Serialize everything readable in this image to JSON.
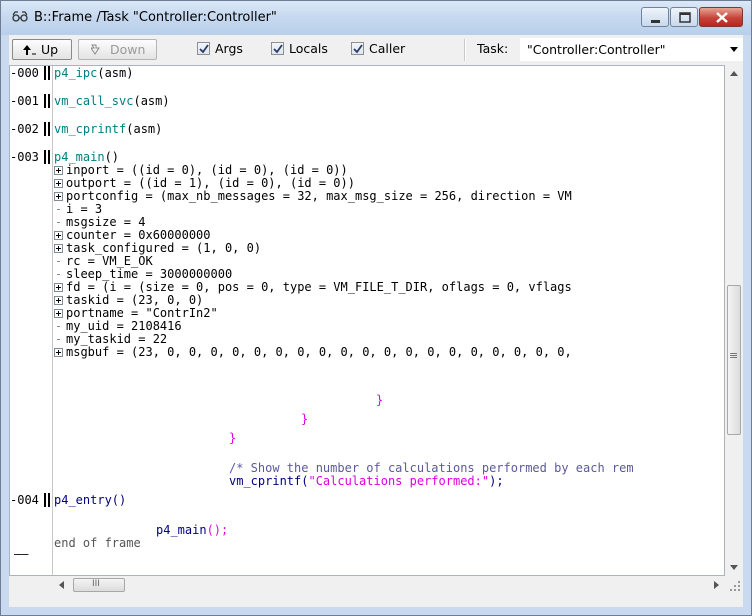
{
  "window": {
    "title": "B::Frame /Task \"Controller:Controller\"",
    "accent": "#c9daee"
  },
  "toolbar": {
    "up_label": "Up",
    "down_label": "Down",
    "args_label": "Args",
    "args_checked": true,
    "locals_label": "Locals",
    "locals_checked": true,
    "caller_label": "Caller",
    "caller_checked": true,
    "task_label": "Task:",
    "task_value": "\"Controller:Controller\""
  },
  "frames": [
    {
      "num": "-000",
      "func": "p4_ipc",
      "suffix": "(asm)"
    },
    {
      "num": "-001",
      "func": "vm_call_svc",
      "suffix": "(asm)"
    },
    {
      "num": "-002",
      "func": "vm_cprintf",
      "suffix": "(asm)"
    },
    {
      "num": "-003",
      "func": "p4_main",
      "suffix": "()"
    },
    {
      "num": "-004",
      "func": "p4_entry",
      "suffix": "()"
    }
  ],
  "locals": [
    {
      "expandable": true,
      "text": "inport = ((id = 0), (id = 0), (id = 0))"
    },
    {
      "expandable": true,
      "text": "outport = ((id = 1), (id = 0), (id = 0))"
    },
    {
      "expandable": true,
      "text": "portconfig = (max_nb_messages = 32, max_msg_size = 256, direction = VM"
    },
    {
      "expandable": false,
      "text": "i = 3"
    },
    {
      "expandable": false,
      "text": "msgsize = 4"
    },
    {
      "expandable": true,
      "text": "counter = 0x60000000"
    },
    {
      "expandable": true,
      "text": "task_configured = (1, 0, 0)"
    },
    {
      "expandable": false,
      "text": "rc = VM_E_OK"
    },
    {
      "expandable": false,
      "text": "sleep_time = 3000000000"
    },
    {
      "expandable": true,
      "text": "fd = (i = (size = 0, pos = 0, type = VM_FILE_T_DIR, oflags = 0, vflags"
    },
    {
      "expandable": true,
      "text": "taskid = (23, 0, 0)"
    },
    {
      "expandable": true,
      "text": "portname = \"ContrIn2\""
    },
    {
      "expandable": false,
      "text": "my_uid = 2108416"
    },
    {
      "expandable": false,
      "text": "my_taskid = 22"
    },
    {
      "expandable": true,
      "text": "msgbuf = (23, 0, 0, 0, 0, 0, 0, 0, 0, 0, 0, 0, 0, 0, 0, 0, 0, 0, 0, 0,"
    }
  ],
  "source": {
    "brace1": "}",
    "brace2": "}",
    "brace3": "}",
    "comment": "/* Show the number of calculations performed by each rem",
    "printf_fn": "vm_cprintf(",
    "printf_str": "\"Calculations performed:\"",
    "printf_end": ");",
    "call_fn": "p4_main",
    "call_args": "();",
    "end_label": "end of frame",
    "end_marker": "——"
  },
  "scrollbar_glyph": "≡",
  "hscroll_glyph": "III"
}
